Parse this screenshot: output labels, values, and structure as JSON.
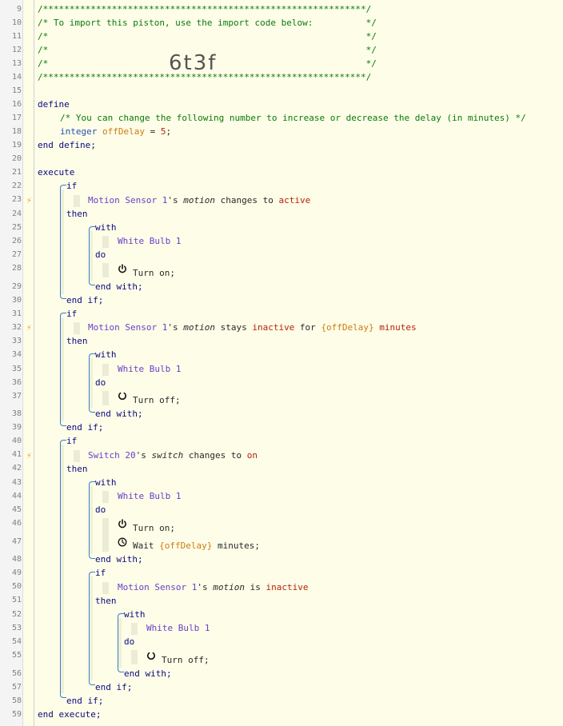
{
  "gutter": {
    "lines": [
      "9",
      "10",
      "11",
      "12",
      "13",
      "14",
      "15",
      "16",
      "17",
      "18",
      "19",
      "20",
      "21",
      "22",
      "23",
      "24",
      "25",
      "26",
      "27",
      "28",
      "29",
      "30",
      "31",
      "32",
      "33",
      "34",
      "35",
      "36",
      "37",
      "38",
      "39",
      "40",
      "41",
      "42",
      "43",
      "44",
      "45",
      "46",
      "47",
      "48",
      "49",
      "50",
      "51",
      "52",
      "53",
      "54",
      "55",
      "56",
      "57",
      "58",
      "59"
    ]
  },
  "header": {
    "stars_top": "/*************************************************************/",
    "import_line": "/* To import this piston, use the import code below:          */",
    "blank_a": "/*                                                            */",
    "blank_b": "/*                                                            */",
    "blank_c": "/*                                                            */",
    "stars_bottom": "/*************************************************************/",
    "piston_id": "6t3f"
  },
  "define": {
    "kw_define": "define",
    "comment": "/* You can change the following number to increase or decrease the delay (in minutes) */",
    "type": "integer",
    "var": "offDelay",
    "eq": " = ",
    "val": "5",
    "semi": ";",
    "kw_end": "end define;"
  },
  "execute": {
    "kw_execute": "execute",
    "kw_end": "end execute;",
    "if1": {
      "kw_if": "if",
      "device": "Motion Sensor 1",
      "poss": "'s ",
      "attr": "motion",
      "op": " changes to ",
      "value": "active",
      "kw_then": "then",
      "kw_with": "with",
      "target": "White Bulb 1",
      "kw_do": "do",
      "task": "Turn on;",
      "kw_end_with": "end with;",
      "kw_end_if": "end if;"
    },
    "if2": {
      "kw_if": "if",
      "device": "Motion Sensor 1",
      "poss": "'s ",
      "attr": "motion",
      "op": " stays ",
      "value": "inactive",
      "op2": " for ",
      "expr": "{offDelay}",
      "unit": " minutes",
      "kw_then": "then",
      "kw_with": "with",
      "target": "White Bulb 1",
      "kw_do": "do",
      "task": "Turn off;",
      "kw_end_with": "end with;",
      "kw_end_if": "end if;"
    },
    "if3": {
      "kw_if": "if",
      "device": "Switch 20",
      "poss": "'s ",
      "attr": "switch",
      "op": " changes to ",
      "value": "on",
      "kw_then": "then",
      "kw_with": "with",
      "target": "White Bulb 1",
      "kw_do": "do",
      "task1": "Turn on;",
      "task2_a": "Wait ",
      "task2_expr": "{offDelay}",
      "task2_b": " minutes;",
      "kw_end_with": "end with;",
      "inner_if": {
        "kw_if": "if",
        "device": "Motion Sensor 1",
        "poss": "'s ",
        "attr": "motion",
        "op": " is ",
        "value": "inactive",
        "kw_then": "then",
        "kw_with": "with",
        "target": "White Bulb 1",
        "kw_do": "do",
        "task": "Turn off;",
        "kw_end_with": "end with;",
        "kw_end_if": "end if;"
      },
      "kw_end_if": "end if;"
    }
  },
  "icons": {
    "trigger": "lightning-bolt-icon",
    "power_on": "power-icon",
    "power_off": "circle-off-icon",
    "wait": "clock-icon"
  },
  "colors": {
    "background": "#fdfde8",
    "comment": "#0a7a0a",
    "keyword": "#0a0a80",
    "device": "#6a3fc8",
    "value": "#b8220a",
    "expression": "#d07a10",
    "bracket": "#3a7ec8",
    "trigger": "#f0a030"
  }
}
